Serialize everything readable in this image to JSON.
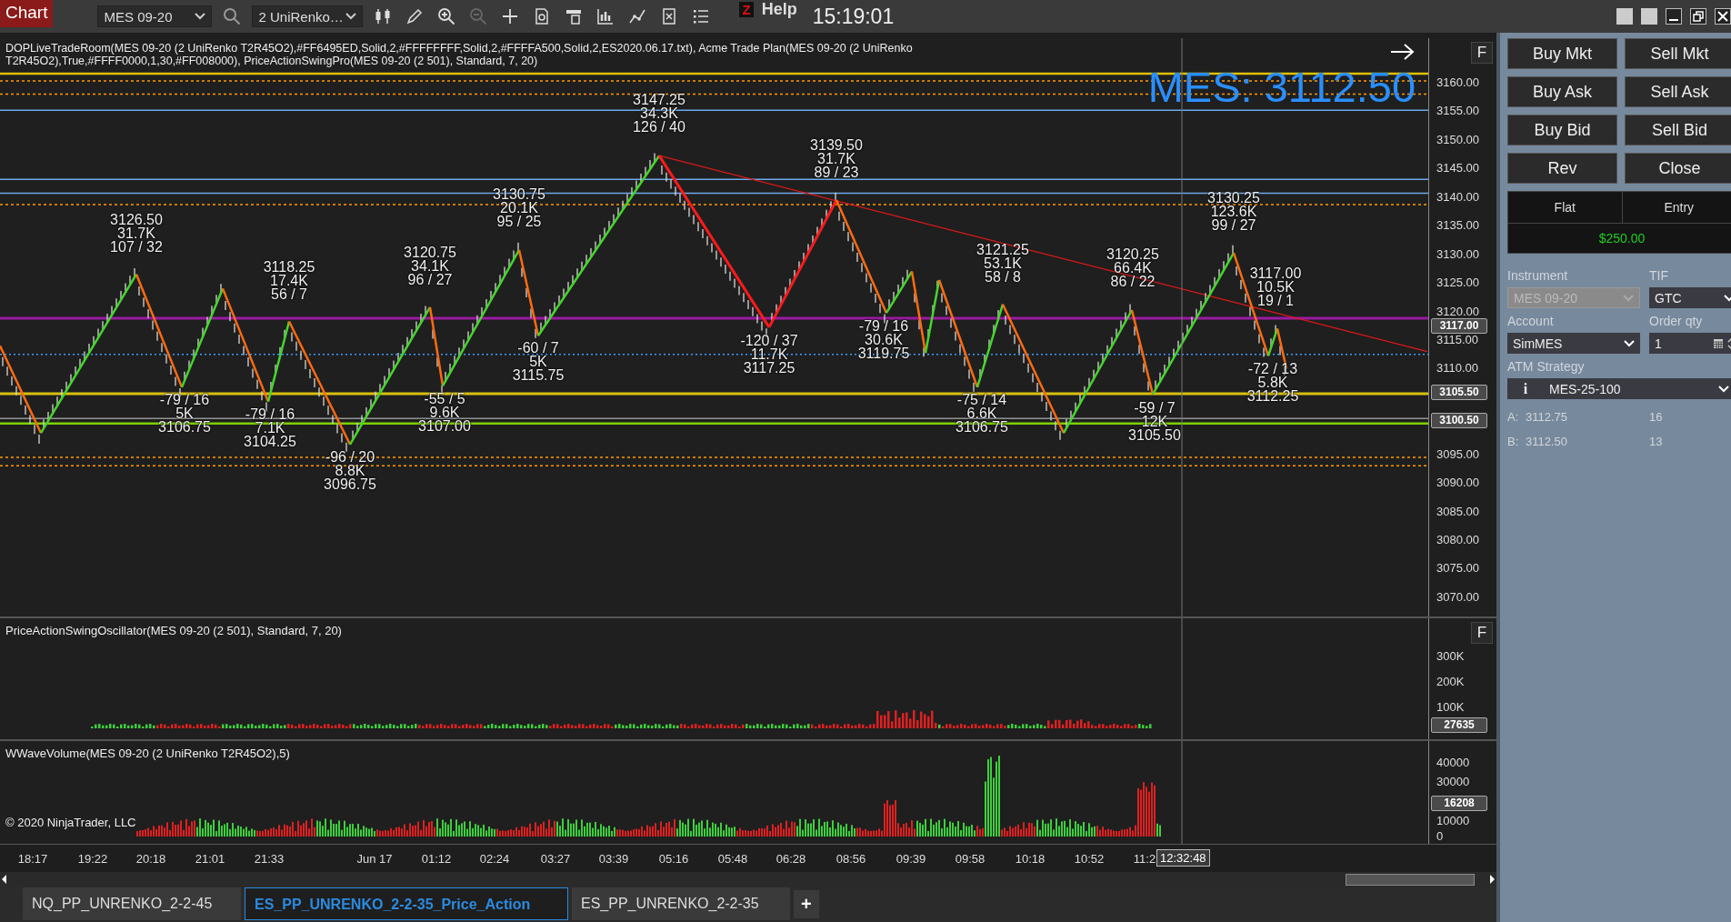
{
  "toolbar": {
    "tab": "Chart",
    "instrument": "MES 09-20",
    "bar_type": "2 UniRenko…",
    "badge": "Z",
    "help": "Help",
    "clock": "15:19:01"
  },
  "price_pane": {
    "indicator_lines": [
      "DOPLiveTradeRoom(MES 09-20 (2 UniRenko T2R45O2),#FF6495ED,Solid,2,#FFFFFFFF,Solid,2,#FFFFA500,Solid,2,ES2020.06.17.txt), Acme Trade Plan(MES 09-20 (2 UniRenko",
      "T2R45O2),True,#FFFF0000,1,30,#FF008000), PriceActionSwingPro(MES 09-20 (2 501), Standard, 7, 20)"
    ],
    "flag": "F",
    "last_price": "MES: 3112.50",
    "axis_ticks": [
      "3160.00",
      "3155.00",
      "3150.00",
      "3145.00",
      "3140.00",
      "3135.00",
      "3130.00",
      "3125.00",
      "3120.00",
      "3115.00",
      "3110.00",
      "3095.00",
      "3090.00",
      "3085.00",
      "3080.00",
      "3075.00",
      "3070.00"
    ],
    "price_markers": [
      "3117.00",
      "3105.50",
      "3100.50"
    ],
    "swing_labels": [
      {
        "lines": [
          "3126.50",
          "31.7K",
          "107 / 32"
        ]
      },
      {
        "lines": [
          "3118.25",
          "17.4K",
          "56 / 7"
        ]
      },
      {
        "lines": [
          "3120.75",
          "34.1K",
          "96 / 27"
        ]
      },
      {
        "lines": [
          "3130.75",
          "20.1K",
          "95 / 25"
        ]
      },
      {
        "lines": [
          "3147.25",
          "34.3K",
          "126 / 40"
        ]
      },
      {
        "lines": [
          "3139.50",
          "31.7K",
          "89 / 23"
        ]
      },
      {
        "lines": [
          "3121.25",
          "53.1K",
          "58 / 8"
        ]
      },
      {
        "lines": [
          "3120.25",
          "66.4K",
          "86 / 22"
        ]
      },
      {
        "lines": [
          "3130.25",
          "123.6K",
          "99 / 27"
        ]
      },
      {
        "lines": [
          "3117.00",
          "10.5K",
          "19 / 1"
        ]
      },
      {
        "lines": [
          "-79 / 16",
          "5K",
          "3106.75"
        ]
      },
      {
        "lines": [
          "-79 / 16",
          "7.1K",
          "3104.25"
        ]
      },
      {
        "lines": [
          "-96 / 20",
          "8.8K",
          "3096.75"
        ]
      },
      {
        "lines": [
          "-55 / 5",
          "9.6K",
          "3107.00"
        ]
      },
      {
        "lines": [
          "-60 / 7",
          "5K",
          "3115.75"
        ]
      },
      {
        "lines": [
          "-120 / 37",
          "11.7K",
          "3117.25"
        ]
      },
      {
        "lines": [
          "-79 / 16",
          "30.6K",
          "3119.75"
        ]
      },
      {
        "lines": [
          "-75 / 14",
          "6.6K",
          "3106.75"
        ]
      },
      {
        "lines": [
          "-59 / 7",
          "12K",
          "3105.50"
        ]
      },
      {
        "lines": [
          "-72 / 13",
          "5.8K",
          "3112.25"
        ]
      }
    ]
  },
  "oscillator_pane": {
    "title": "PriceActionSwingOscillator(MES 09-20 (2 501), Standard, 7, 20)",
    "flag": "F",
    "axis_ticks": [
      "300K",
      "200K",
      "100K"
    ],
    "marker": "27635"
  },
  "volume_pane": {
    "title": "WWaveVolume(MES 09-20 (2 UniRenko T2R45O2),5)",
    "copyright": "© 2020 NinjaTrader, LLC",
    "axis_ticks": [
      "40000",
      "30000",
      "10000",
      "0"
    ],
    "marker": "16208"
  },
  "time_axis": {
    "ticks": [
      "18:17",
      "19:22",
      "20:18",
      "21:01",
      "21:33",
      "Jun 17",
      "01:12",
      "02:24",
      "03:27",
      "03:39",
      "05:16",
      "05:48",
      "06:28",
      "08:56",
      "09:39",
      "09:58",
      "10:18",
      "10:52",
      "11:2"
    ],
    "crosshair": "12:32:48"
  },
  "tabs": [
    {
      "label": "NQ_PP_UNRENKO_2-2-45",
      "selected": false
    },
    {
      "label": "ES_PP_UNRENKO_2-2-35_Price_Action",
      "selected": true
    },
    {
      "label": "ES_PP_UNRENKO_2-2-35",
      "selected": false
    }
  ],
  "add_tab": "+",
  "order_panel": {
    "buttons": [
      "Buy Mkt",
      "Sell Mkt",
      "Buy Ask",
      "Sell Ask",
      "Buy Bid",
      "Sell Bid",
      "Rev",
      "Close"
    ],
    "position": "Flat",
    "entry": "Entry",
    "pnl": "$250.00",
    "instrument_label": "Instrument",
    "instrument": {
      "value": "MES 09-20",
      "disabled": true
    },
    "tif_label": "TIF",
    "tif": "GTC",
    "account_label": "Account",
    "account": "SimMES",
    "qty_label": "Order qty",
    "qty": "1",
    "atm_label": "ATM Strategy",
    "atm_info": "i",
    "atm": "MES-25-100",
    "quotes": [
      {
        "side": "A:",
        "price": "3112.75",
        "size": "16"
      },
      {
        "side": "B:",
        "price": "3112.50",
        "size": "13"
      }
    ]
  }
}
